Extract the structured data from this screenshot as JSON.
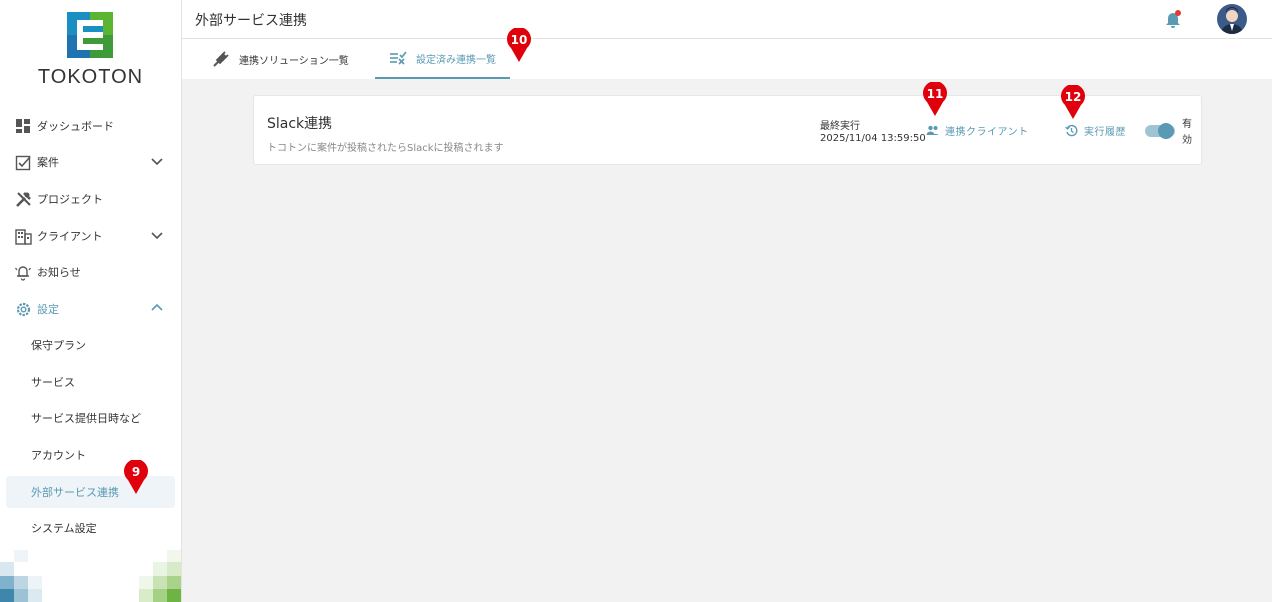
{
  "brand": {
    "name": "TOKOTON"
  },
  "sidebar": {
    "items": [
      {
        "label": "ダッシュボード"
      },
      {
        "label": "案件"
      },
      {
        "label": "プロジェクト"
      },
      {
        "label": "クライアント"
      },
      {
        "label": "お知らせ"
      },
      {
        "label": "設定"
      }
    ],
    "settings_sub": [
      {
        "label": "保守プラン"
      },
      {
        "label": "サービス"
      },
      {
        "label": "サービス提供日時など"
      },
      {
        "label": "アカウント"
      },
      {
        "label": "外部サービス連携"
      },
      {
        "label": "システム設定"
      }
    ]
  },
  "header": {
    "title": "外部サービス連携"
  },
  "tabs": [
    {
      "label": "連携ソリューション一覧"
    },
    {
      "label": "設定済み連携一覧"
    }
  ],
  "integration": {
    "title": "Slack連携",
    "description": "トコトンに案件が投稿されたらSlackに投稿されます",
    "last_run_label": "最終実行",
    "last_run_value": "2025/11/04 13:59:50",
    "clients_link": "連携クライアント",
    "history_link": "実行履歴",
    "toggle_label": "有効",
    "enabled": true
  },
  "markers": [
    {
      "number": "9"
    },
    {
      "number": "10"
    },
    {
      "number": "11"
    },
    {
      "number": "12"
    }
  ],
  "colors": {
    "accent": "#5a9ab3",
    "marker": "#e0000b",
    "notification_dot": "#e53935"
  }
}
